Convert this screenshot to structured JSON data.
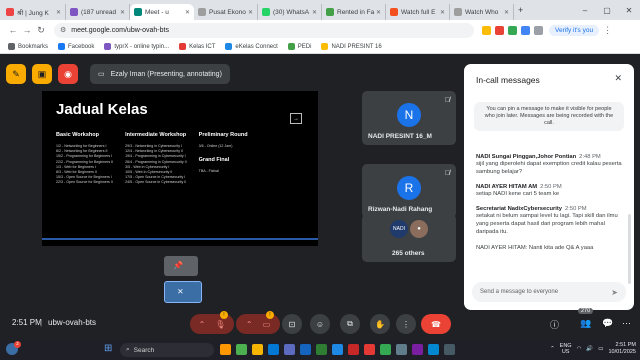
{
  "browser": {
    "tabs": [
      {
        "label": "श्री | Jung K",
        "color": "#e44"
      },
      {
        "label": "(187 unread",
        "color": "#7e57c2"
      },
      {
        "label": "Meet - u",
        "color": "#00897b",
        "active": true
      },
      {
        "label": "Pusat Ekono",
        "color": "#9e9e9e"
      },
      {
        "label": "(30) WhatsA",
        "color": "#25d366"
      },
      {
        "label": "Rented in Fa",
        "color": "#43a047"
      },
      {
        "label": "Watch full E",
        "color": "#f4511e"
      },
      {
        "label": "Watch Who",
        "color": "#9e9e9e"
      }
    ],
    "url": "meet.google.com/ubw-ovah-bts",
    "verify_label": "Verify it's you",
    "bookmarks": [
      "Bookmarks",
      "Facebook",
      "typrX - online typin...",
      "Kelas ICT",
      "eKelas Connect",
      "PEDi",
      "NADI PRESINT 16"
    ]
  },
  "meet": {
    "presenter_label": "Ezaly Iman (Presenting, annotating)",
    "slide": {
      "title": "Jadual Kelas",
      "columns": [
        {
          "heading": "Basic Workshop",
          "lines": [
            "1/2 - Networking for Beginners I",
            "8/2 - Networking for Beginners II",
            "15/2 - Programming for Beginners I",
            "22/2 - Programming for Beginners II",
            "1/3 - Web for Beginners I",
            "8/3 - Web for Beginners II",
            "15/3 - Open Source for Beginners I",
            "22/3 - Open Source for Beginners II"
          ]
        },
        {
          "heading": "Intermediate Workshop",
          "lines": [
            "29/3 - Networking in Cybersecurity I",
            "12/4 - Networking in Cybersecurity II",
            "19/4 - Programming in Cybersecurity I",
            "26/4 - Programming in Cybersecurity II",
            "3/5 - Web in Cybersecurity I",
            "10/5 - Web in Cybersecurity II",
            "17/5 - Open Source in Cybersecurity I",
            "24/5 - Open Source in Cybersecurity II"
          ]
        },
        {
          "heading": "Preliminary Round",
          "lines": [
            "3/6 - Online (12 Jam)"
          ],
          "heading2": "Grand Final",
          "lines2": [
            "TBA - Fizikal"
          ]
        }
      ]
    },
    "participants": [
      {
        "name": "NADI PRESINT 16_M",
        "initial": "N",
        "color": "#1a73e8"
      },
      {
        "name": "Rizwan-Nadi Rahang",
        "initial": "R",
        "color": "#1a73e8"
      },
      {
        "name": "265 others"
      }
    ],
    "time": "2:51 PM",
    "meeting_code": "ubw-ovah-bts",
    "participant_count": "270"
  },
  "chat": {
    "title": "In-call messages",
    "note": "You can pin a message to make it visible for people who join later. Messages are being recorded with the call.",
    "messages": [
      {
        "sender": "NADI Sungai Pinggan,Johor Pontian",
        "time": "2:48 PM",
        "text": "sijil yang diperolehi dapat exemption credit kalau peserta sambung belajar?"
      },
      {
        "sender": "NADI AYER HITAM AM",
        "time": "2:50 PM",
        "text": "setiap NADI kene cari 5 team ke"
      },
      {
        "sender": "Secretariat NadixCybersecurity",
        "time": "2:50 PM",
        "text": "setakat ni belum sampai level tu lagi. Tapi skill dan ilmu yang peserta dapat hasil dari program lebih mahal daripada itu."
      },
      {
        "sender": "",
        "time": "",
        "text": "NADI AYER HITAM: Nanti kita ade Q& A yaaa"
      }
    ],
    "input_placeholder": "Send a message to everyone"
  },
  "taskbar": {
    "search_placeholder": "Search",
    "lang": "ENG",
    "region": "US",
    "time": "2:51 PM",
    "date": "10/01/2025",
    "notif_count": "2"
  }
}
